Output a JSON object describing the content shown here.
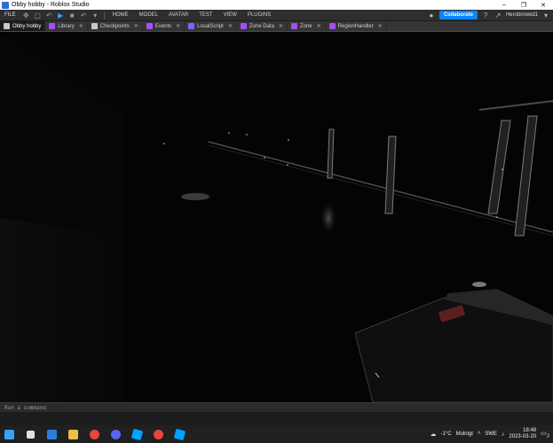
{
  "window": {
    "title": "Obby hobby - Roblox Studio",
    "controls": [
      "–",
      "❐",
      "✕"
    ]
  },
  "menubar": {
    "file_label": "FILE",
    "tools": [
      "✥",
      "▢",
      "↶",
      "▶",
      "■",
      "↶",
      "▾"
    ],
    "items": [
      "HOME",
      "MODEL",
      "AVATAR",
      "TEST",
      "VIEW",
      "PLUGINS"
    ],
    "collaborate_label": "Collaborate",
    "username": "Herobrinekd1"
  },
  "tabs": [
    {
      "label": "Obby hobby",
      "color": "#c9c9c9"
    },
    {
      "label": "Library",
      "color": "#a64dff"
    },
    {
      "label": "Checkpoints",
      "color": "#c9c9c9"
    },
    {
      "label": "Events",
      "color": "#a64dff"
    },
    {
      "label": "LocalScript",
      "color": "#8a5cff"
    },
    {
      "label": "Zone Data",
      "color": "#a64dff"
    },
    {
      "label": "Zone",
      "color": "#a64dff"
    },
    {
      "label": "RegionHandler",
      "color": "#a64dff"
    }
  ],
  "command_bar": {
    "placeholder": "Run a command"
  },
  "taskbar": {
    "apps": [
      {
        "name": "windows-start-icon",
        "color": "#3aa0ff"
      },
      {
        "name": "task-view-icon",
        "color": "#e0e0e0"
      },
      {
        "name": "mail-icon",
        "color": "#2c7de0"
      },
      {
        "name": "file-explorer-icon",
        "color": "#f0c040"
      },
      {
        "name": "chrome-icon",
        "color": "#e8453c"
      },
      {
        "name": "discord-icon",
        "color": "#5865f2"
      },
      {
        "name": "roblox-studio-icon",
        "color": "#00a2ff"
      },
      {
        "name": "chrome-icon",
        "color": "#e8453c"
      },
      {
        "name": "roblox-studio-icon",
        "color": "#00a2ff"
      }
    ],
    "weather_temp": "-1°C",
    "weather_text": "Molnigt",
    "language": "SWE",
    "time": "18:48",
    "date": "2023-03-20",
    "notification_count": "3"
  }
}
